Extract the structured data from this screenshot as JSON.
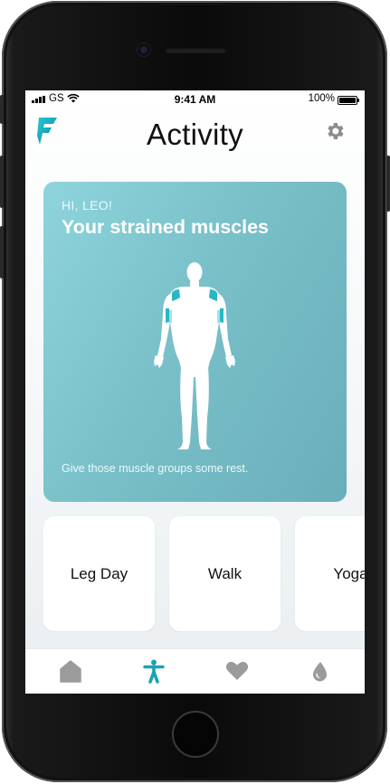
{
  "status_bar": {
    "carrier": "GS",
    "time": "9:41 AM",
    "battery": "100%"
  },
  "header": {
    "title": "Activity",
    "logo_icon": "app-logo-icon",
    "settings_icon": "gear-icon"
  },
  "card": {
    "greeting": "HI, LEO!",
    "title": "Your strained muscles",
    "footer": "Give those muscle groups some rest.",
    "strained_areas": [
      "left-shoulder",
      "right-shoulder",
      "left-upper-arm",
      "right-upper-arm"
    ]
  },
  "activities": [
    {
      "label": "Leg Day"
    },
    {
      "label": "Walk"
    },
    {
      "label": "Yoga"
    }
  ],
  "tab_bar": [
    {
      "icon": "home-icon",
      "active": false
    },
    {
      "icon": "activity-person-icon",
      "active": true
    },
    {
      "icon": "heart-icon",
      "active": false
    },
    {
      "icon": "water-drop-icon",
      "active": false
    }
  ],
  "colors": {
    "accent": "#1aa3b3",
    "card_start": "#8fd4dc",
    "card_end": "#6aaeb9",
    "tab_inactive": "#9b9b9b",
    "strain": "#2bb6c4"
  }
}
